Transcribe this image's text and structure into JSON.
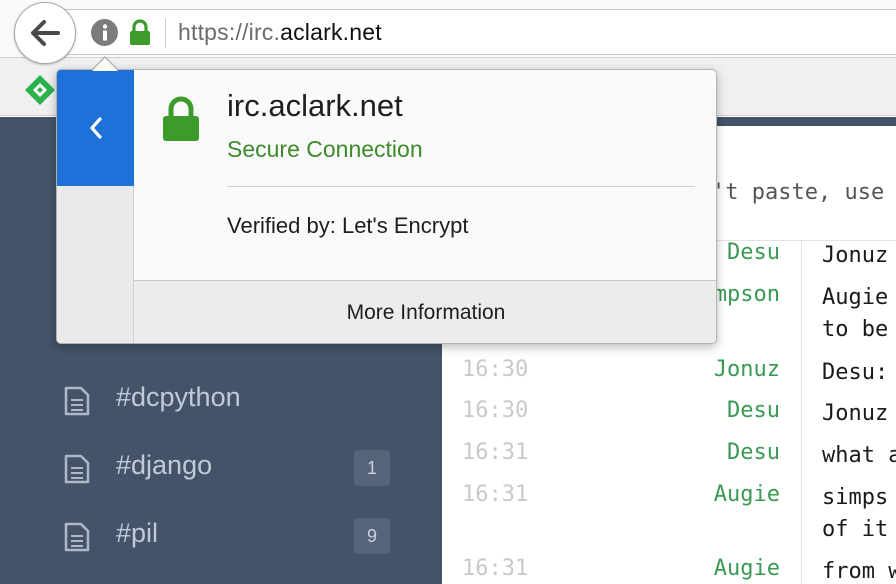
{
  "toolbar": {
    "url_scheme": "https://irc.",
    "url_host": "aclark.net",
    "back_icon": "arrow-left-icon",
    "info_icon": "info-icon",
    "lock_icon": "lock-icon"
  },
  "sidebar": {
    "channels": [
      {
        "name": "#dcpython",
        "badge": ""
      },
      {
        "name": "#django",
        "badge": "1"
      },
      {
        "name": "#pil",
        "badge": "9"
      }
    ]
  },
  "chat": {
    "topic": "'t paste, use",
    "messages": [
      {
        "time": "",
        "nick": "Desu",
        "msg": "Jonuz"
      },
      {
        "time": "",
        "nick": "mpson",
        "msg": "Augie\nto be"
      },
      {
        "time": "16:30",
        "nick": "Jonuz",
        "msg": "Desu:"
      },
      {
        "time": "16:30",
        "nick": "Desu",
        "msg": "Jonuz"
      },
      {
        "time": "16:31",
        "nick": "Desu",
        "msg": "what a"
      },
      {
        "time": "16:31",
        "nick": "Augie",
        "msg": "simps\nof it"
      },
      {
        "time": "16:31",
        "nick": "Augie",
        "msg": "from w"
      }
    ]
  },
  "popup": {
    "title": "irc.aclark.net",
    "status": "Secure Connection",
    "verified": "Verified by: Let's Encrypt",
    "more_button": "More Information"
  },
  "colors": {
    "accent_blue": "#1d71d9",
    "secure_green": "#3d8a2a",
    "sidebar_bg": "#44536a",
    "nick_green": "#3a9a53"
  }
}
